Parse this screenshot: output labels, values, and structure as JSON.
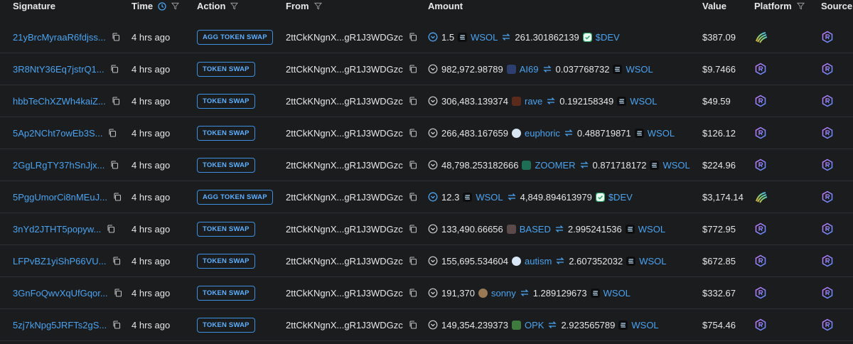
{
  "columns": {
    "signature": "Signature",
    "time": "Time",
    "action": "Action",
    "from": "From",
    "amount": "Amount",
    "value": "Value",
    "platform": "Platform",
    "source": "Source"
  },
  "colors": {
    "background": "#1b1c1e",
    "link": "#4aa3f0",
    "badge_border": "#3d8fe0",
    "row_divider": "#2e3033"
  },
  "rows": [
    {
      "signature": "21yBrcMyraaR6fdjss...",
      "time": "4 hrs ago",
      "action": "AGG TOKEN SWAP",
      "from": "2ttCkKNgnX...gR1J3WDGzc",
      "amount_in": "1.5",
      "token_in": "WSOL",
      "amount_out": "261.301862139",
      "token_out": "$DEV",
      "token_in_icon": "wsol-icon",
      "token_out_icon": "dev-check-icon",
      "value": "$387.09",
      "platform": "meteora-icon",
      "source": "raydium-icon"
    },
    {
      "signature": "3R8NtY36Eq7jstrQ1...",
      "time": "4 hrs ago",
      "action": "TOKEN SWAP",
      "from": "2ttCkKNgnX...gR1J3WDGzc",
      "amount_in": "982,972.98789",
      "token_in": "AI69",
      "amount_out": "0.037768732",
      "token_out": "WSOL",
      "token_in_icon": "ai69-icon",
      "token_out_icon": "wsol-icon",
      "value": "$9.7466",
      "platform": "raydium-icon",
      "source": "raydium-icon"
    },
    {
      "signature": "hbbTeChXZWh4kaiZ...",
      "time": "4 hrs ago",
      "action": "TOKEN SWAP",
      "from": "2ttCkKNgnX...gR1J3WDGzc",
      "amount_in": "306,483.139374",
      "token_in": "rave",
      "amount_out": "0.192158349",
      "token_out": "WSOL",
      "token_in_icon": "rave-icon",
      "token_out_icon": "wsol-icon",
      "value": "$49.59",
      "platform": "raydium-icon",
      "source": "raydium-icon"
    },
    {
      "signature": "5Ap2NCht7owEb3S...",
      "time": "4 hrs ago",
      "action": "TOKEN SWAP",
      "from": "2ttCkKNgnX...gR1J3WDGzc",
      "amount_in": "266,483.167659",
      "token_in": "euphoric",
      "amount_out": "0.488719871",
      "token_out": "WSOL",
      "token_in_icon": "euphoric-icon",
      "token_out_icon": "wsol-icon",
      "value": "$126.12",
      "platform": "raydium-icon",
      "source": "raydium-icon"
    },
    {
      "signature": "2GgLRgTY37hSnJjx...",
      "time": "4 hrs ago",
      "action": "TOKEN SWAP",
      "from": "2ttCkKNgnX...gR1J3WDGzc",
      "amount_in": "48,798.253182666",
      "token_in": "ZOOMER",
      "amount_out": "0.871718172",
      "token_out": "WSOL",
      "token_in_icon": "zoomer-icon",
      "token_out_icon": "wsol-icon",
      "value": "$224.96",
      "platform": "raydium-icon",
      "source": "raydium-icon"
    },
    {
      "signature": "5PggUmorCi8nMEuJ...",
      "time": "4 hrs ago",
      "action": "AGG TOKEN SWAP",
      "from": "2ttCkKNgnX...gR1J3WDGzc",
      "amount_in": "12.3",
      "token_in": "WSOL",
      "amount_out": "4,849.894613979",
      "token_out": "$DEV",
      "token_in_icon": "wsol-icon",
      "token_out_icon": "dev-check-icon",
      "value": "$3,174.14",
      "platform": "meteora-icon",
      "source": "raydium-icon"
    },
    {
      "signature": "3nYd2JTHT5popyw...",
      "time": "4 hrs ago",
      "action": "TOKEN SWAP",
      "from": "2ttCkKNgnX...gR1J3WDGzc",
      "amount_in": "133,490.66656",
      "token_in": "BASED",
      "amount_out": "2.995241536",
      "token_out": "WSOL",
      "token_in_icon": "based-icon",
      "token_out_icon": "wsol-icon",
      "value": "$772.95",
      "platform": "raydium-icon",
      "source": "raydium-icon"
    },
    {
      "signature": "LFPvBZ1yiShP66VU...",
      "time": "4 hrs ago",
      "action": "TOKEN SWAP",
      "from": "2ttCkKNgnX...gR1J3WDGzc",
      "amount_in": "155,695.534604",
      "token_in": "autism",
      "amount_out": "2.607352032",
      "token_out": "WSOL",
      "token_in_icon": "autism-icon",
      "token_out_icon": "wsol-icon",
      "value": "$672.85",
      "platform": "raydium-icon",
      "source": "raydium-icon"
    },
    {
      "signature": "3GnFoQwvXqUfGqor...",
      "time": "4 hrs ago",
      "action": "TOKEN SWAP",
      "from": "2ttCkKNgnX...gR1J3WDGzc",
      "amount_in": "191,370",
      "token_in": "sonny",
      "amount_out": "1.289129673",
      "token_out": "WSOL",
      "token_in_icon": "sonny-icon",
      "token_out_icon": "wsol-icon",
      "value": "$332.67",
      "platform": "raydium-icon",
      "source": "raydium-icon"
    },
    {
      "signature": "5zj7kNpg5JRFTs2gS...",
      "time": "4 hrs ago",
      "action": "TOKEN SWAP",
      "from": "2ttCkKNgnX...gR1J3WDGzc",
      "amount_in": "149,354.239373",
      "token_in": "OPK",
      "amount_out": "2.923565789",
      "token_out": "WSOL",
      "token_in_icon": "opk-icon",
      "token_out_icon": "wsol-icon",
      "value": "$754.46",
      "platform": "raydium-icon",
      "source": "raydium-icon"
    }
  ]
}
